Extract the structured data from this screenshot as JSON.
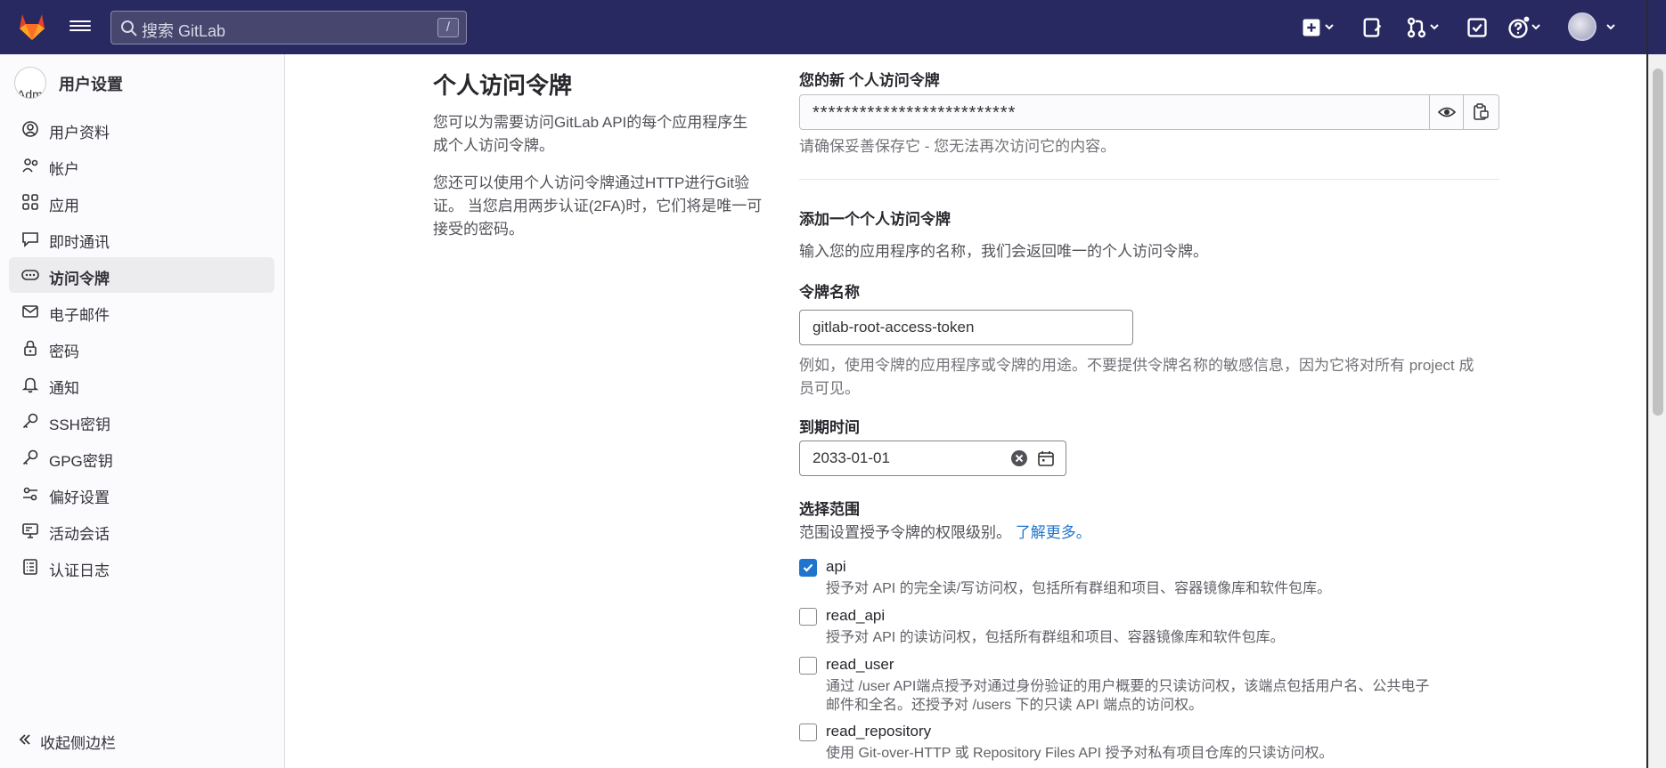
{
  "topbar": {
    "search_placeholder": "搜索 GitLab",
    "search_shortcut": "/"
  },
  "sidebar": {
    "avatar_text": "Adm",
    "title": "用户设置",
    "items": [
      {
        "label": "用户资料",
        "icon": "profile-icon"
      },
      {
        "label": "帐户",
        "icon": "account-icon"
      },
      {
        "label": "应用",
        "icon": "applications-icon"
      },
      {
        "label": "即时通讯",
        "icon": "chat-icon"
      },
      {
        "label": "访问令牌",
        "icon": "token-icon",
        "active": true
      },
      {
        "label": "电子邮件",
        "icon": "mail-icon"
      },
      {
        "label": "密码",
        "icon": "lock-icon"
      },
      {
        "label": "通知",
        "icon": "notifications-icon"
      },
      {
        "label": "SSH密钥",
        "icon": "key-icon"
      },
      {
        "label": "GPG密钥",
        "icon": "key-icon"
      },
      {
        "label": "偏好设置",
        "icon": "preferences-icon"
      },
      {
        "label": "活动会话",
        "icon": "monitor-icon"
      },
      {
        "label": "认证日志",
        "icon": "log-icon"
      }
    ],
    "collapse_label": "收起侧边栏"
  },
  "intro": {
    "title": "个人访问令牌",
    "paragraph1": "您可以为需要访问GitLab API的每个应用程序生成个人访问令牌。",
    "paragraph2": "您还可以使用个人访问令牌通过HTTP进行Git验证。 当您启用两步认证(2FA)时，它们将是唯一可接受的密码。"
  },
  "new_token": {
    "label": "您的新 个人访问令牌",
    "value": "**************************",
    "hint": "请确保妥善保存它 - 您无法再次访问它的内容。"
  },
  "add_token": {
    "heading": "添加一个个人访问令牌",
    "description": "输入您的应用程序的名称，我们会返回唯一的个人访问令牌。",
    "name_label": "令牌名称",
    "name_value": "gitlab-root-access-token",
    "name_hint_line1": "例如，使用令牌的应用程序或令牌的用途。不要提供令牌名称的敏感信息，因为它将对所有 project 成",
    "name_hint_line2": "员可见。",
    "expiry_label": "到期时间",
    "expiry_value": "2033-01-01",
    "scopes_label": "选择范围",
    "scopes_hint": "范围设置授予令牌的权限级别。",
    "learn_more": "了解更多。",
    "scopes": [
      {
        "name": "api",
        "checked": true,
        "desc": "授予对 API 的完全读/写访问权，包括所有群组和项目、容器镜像库和软件包库。"
      },
      {
        "name": "read_api",
        "checked": false,
        "desc": "授予对 API 的读访问权，包括所有群组和项目、容器镜像库和软件包库。"
      },
      {
        "name": "read_user",
        "checked": false,
        "desc": "通过 /user API端点授予对通过身份验证的用户概要的只读访问权，该端点包括用户名、公共电子",
        "desc2": "邮件和全名。还授予对 /users 下的只读 API 端点的访问权。"
      },
      {
        "name": "read_repository",
        "checked": false,
        "desc": "使用 Git-over-HTTP 或 Repository Files API 授予对私有项目仓库的只读访问权。"
      }
    ]
  }
}
